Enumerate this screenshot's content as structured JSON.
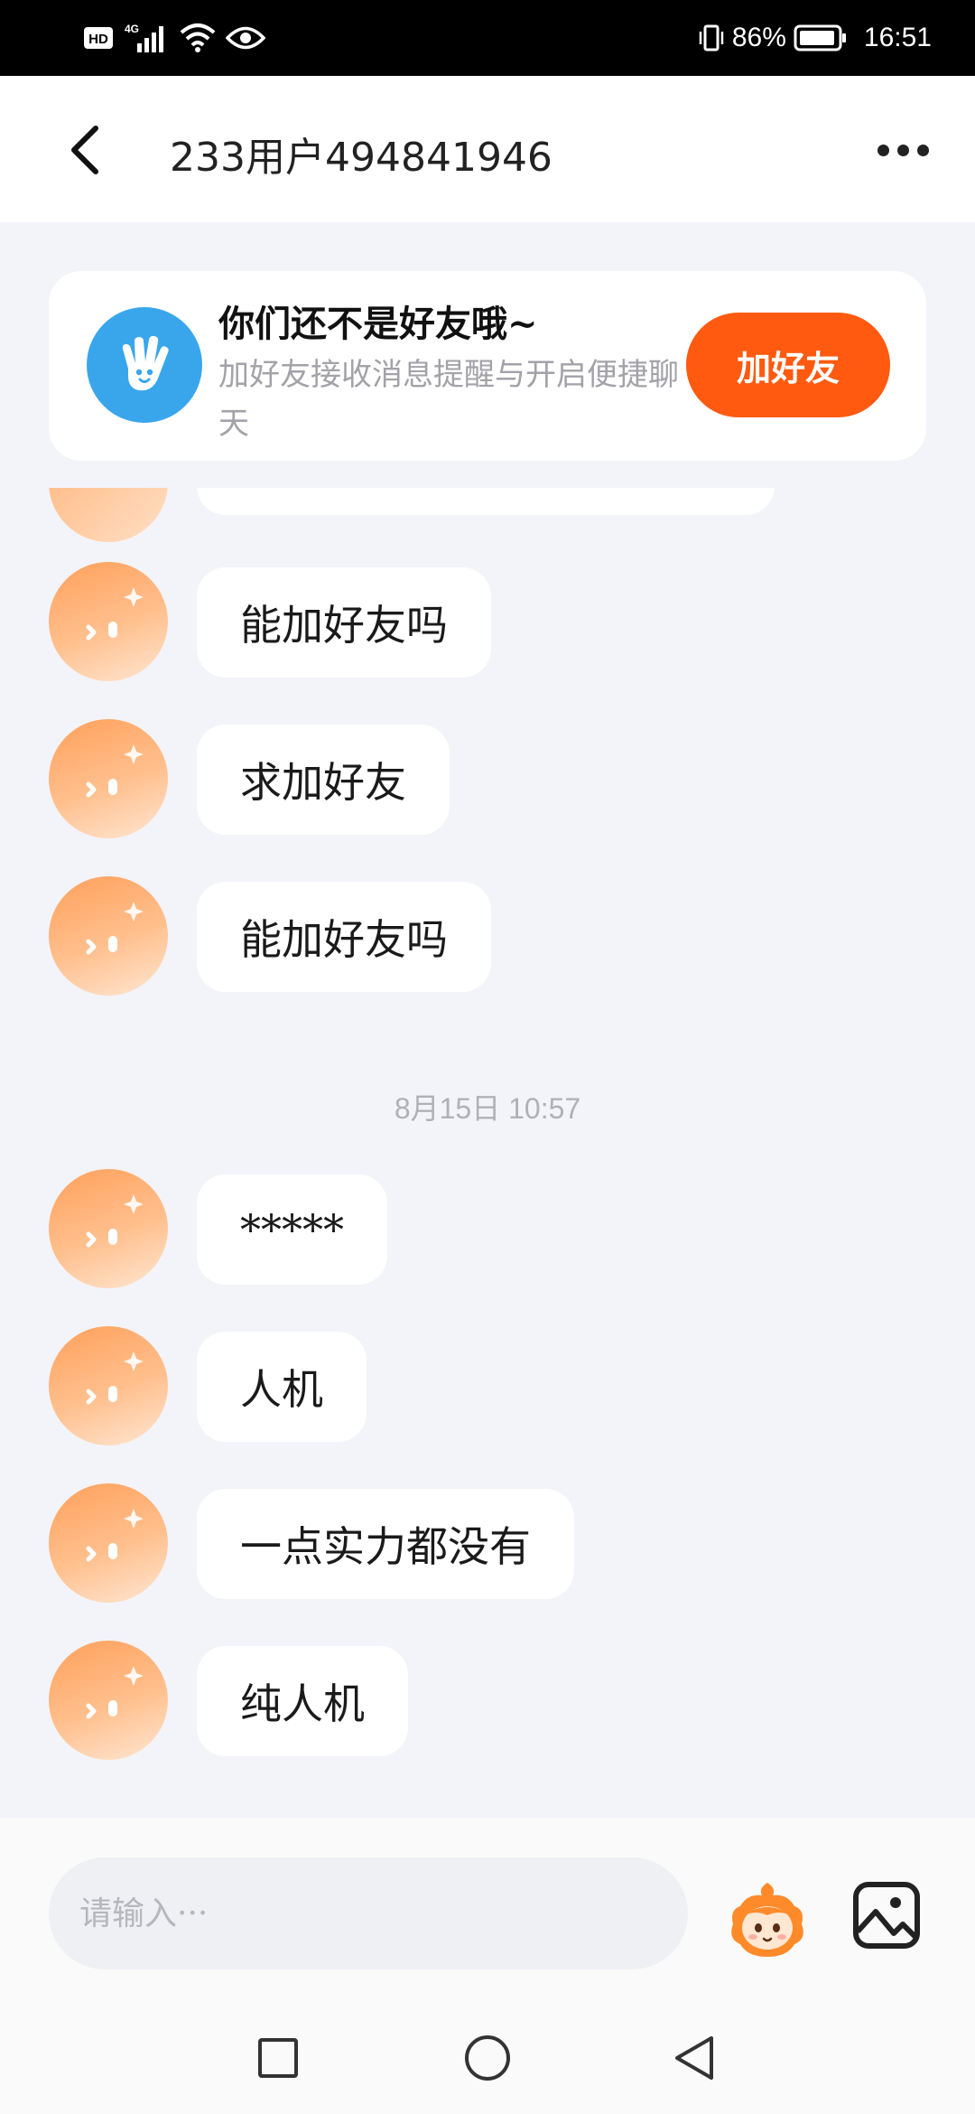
{
  "status_bar": {
    "hd_label": "HD",
    "network_label": "4G",
    "battery_percent": "86%",
    "time": "16:51"
  },
  "header": {
    "title": "233用户494841946",
    "back_icon": "chevron-left-icon",
    "more_icon": "more-dots-icon"
  },
  "friend_banner": {
    "title": "你们还不是好友哦~",
    "description": "加好友接收消息提醒与开启便捷聊天",
    "button_label": "加好友",
    "avatar_icon": "waving-hand-icon"
  },
  "messages_before": [
    {
      "text": "能加好友吗"
    },
    {
      "text": "求加好友"
    },
    {
      "text": "能加好友吗"
    }
  ],
  "timestamp": "8月15日  10:57",
  "messages_after": [
    {
      "text": "*****"
    },
    {
      "text": "人机"
    },
    {
      "text": "一点实力都没有"
    },
    {
      "text": "纯人机"
    }
  ],
  "input_bar": {
    "placeholder": "请输入···",
    "emoji_icon": "mascot-emoji-icon",
    "image_icon": "image-picker-icon"
  },
  "nav_bar": {
    "icons": [
      "square-recent-icon",
      "circle-home-icon",
      "triangle-back-icon"
    ]
  },
  "colors": {
    "accent": "#ff5a10",
    "background": "#f3f4f9",
    "avatar": "#ffa05b",
    "banner_avatar": "#39a6ec"
  }
}
